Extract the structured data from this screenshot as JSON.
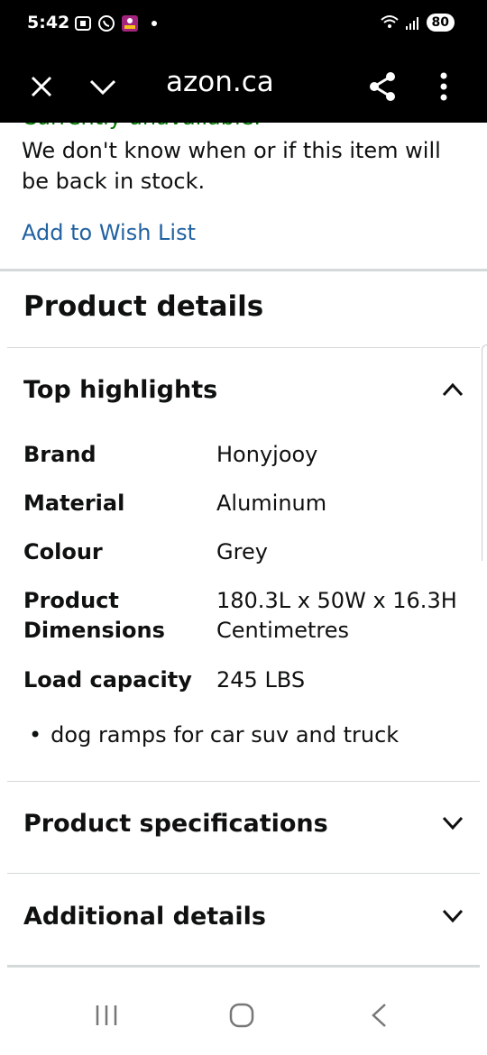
{
  "status_bar": {
    "time": "5:42",
    "battery": "80"
  },
  "toolbar": {
    "url": "azon.ca"
  },
  "page": {
    "availability": "Currently unavailable.",
    "stock_message": "We don't know when or if this item will be back in stock.",
    "wish_list": "Add to Wish List",
    "product_details_title": "Product details",
    "top_highlights_title": "Top highlights",
    "highlights": [
      {
        "key": "Brand",
        "value": "Honyjooy"
      },
      {
        "key": "Material",
        "value": "Aluminum"
      },
      {
        "key": "Colour",
        "value": "Grey"
      },
      {
        "key": "Product Dimensions",
        "value": "180.3L x 50W x 16.3H Centimetres"
      },
      {
        "key": "Load capacity",
        "value": "245 LBS"
      }
    ],
    "bullet": "dog ramps for car suv and truck",
    "product_specifications_title": "Product specifications",
    "additional_details_title": "Additional details"
  },
  "colors": {
    "link": "#2162a1",
    "available_green": "#007600",
    "divider": "#d5d9d9"
  }
}
